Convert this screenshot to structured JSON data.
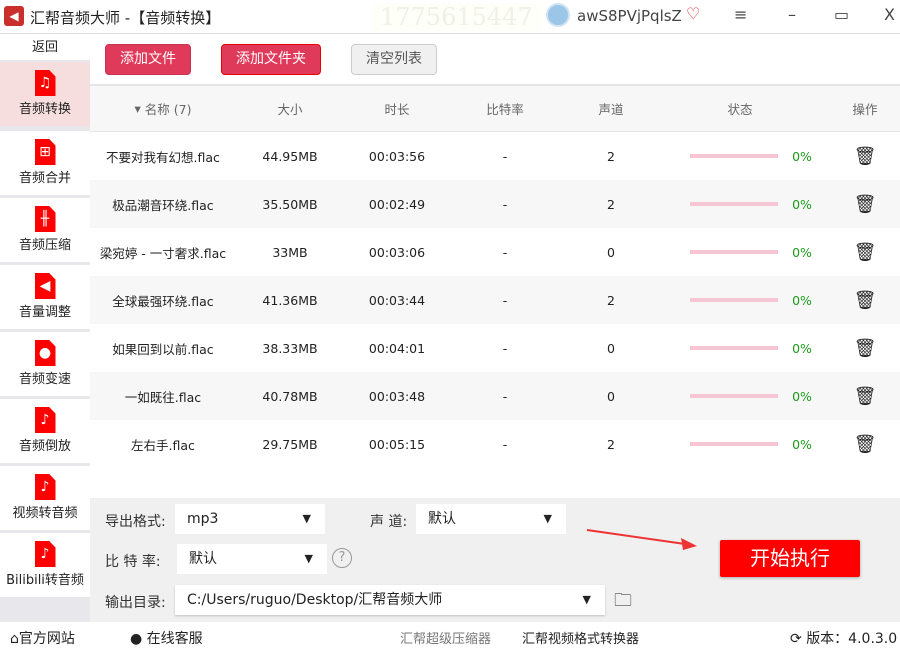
{
  "titlebar": {
    "app_name": "汇帮音频大师",
    "page": "-【音频转换】",
    "watermark": "1775615447",
    "username": "awS8PVjPqlsZ"
  },
  "sidebar": {
    "back": "返回",
    "items": [
      {
        "label": "音频转换",
        "icon": "♫"
      },
      {
        "label": "音频合并",
        "icon": "⊞"
      },
      {
        "label": "音频压缩",
        "icon": "╫"
      },
      {
        "label": "音量调整",
        "icon": "◀"
      },
      {
        "label": "音频变速",
        "icon": "●"
      },
      {
        "label": "音频倒放",
        "icon": "♪"
      },
      {
        "label": "视频转音频",
        "icon": "♪"
      },
      {
        "label": "Bilibili转音频",
        "icon": "♪"
      }
    ]
  },
  "toolbar": {
    "add_file": "添加文件",
    "add_folder": "添加文件夹",
    "clear_list": "清空列表"
  },
  "table": {
    "headers": {
      "name": "名称 (7)",
      "size": "大小",
      "duration": "时长",
      "bitrate": "比特率",
      "channel": "声道",
      "status": "状态",
      "ops": "操作"
    },
    "rows": [
      {
        "name": "不要对我有幻想.flac",
        "size": "44.95MB",
        "duration": "00:03:56",
        "bitrate": "-",
        "channel": "2",
        "progress": "0%"
      },
      {
        "name": "极品潮音环绕.flac",
        "size": "35.50MB",
        "duration": "00:02:49",
        "bitrate": "-",
        "channel": "2",
        "progress": "0%"
      },
      {
        "name": "梁宛婷 - 一寸奢求.flac",
        "size": "33MB",
        "duration": "00:03:06",
        "bitrate": "-",
        "channel": "0",
        "progress": "0%"
      },
      {
        "name": "全球最强环绕.flac",
        "size": "41.36MB",
        "duration": "00:03:44",
        "bitrate": "-",
        "channel": "2",
        "progress": "0%"
      },
      {
        "name": "如果回到以前.flac",
        "size": "38.33MB",
        "duration": "00:04:01",
        "bitrate": "-",
        "channel": "0",
        "progress": "0%"
      },
      {
        "name": "一如既往.flac",
        "size": "40.78MB",
        "duration": "00:03:48",
        "bitrate": "-",
        "channel": "0",
        "progress": "0%"
      },
      {
        "name": "左右手.flac",
        "size": "29.75MB",
        "duration": "00:05:15",
        "bitrate": "-",
        "channel": "2",
        "progress": "0%"
      }
    ]
  },
  "settings": {
    "format_label": "导出格式:",
    "format_value": "mp3",
    "channel_label": "声 道:",
    "channel_value": "默认",
    "bitrate_label": "比 特 率:",
    "bitrate_value": "默认",
    "help": "?",
    "output_label": "输出目录:",
    "output_value": "C:/Users/ruguo/Desktop/汇帮音频大师",
    "start": "开始执行"
  },
  "footer": {
    "website": "官方网站",
    "support": "在线客服",
    "link1": "汇帮超级压缩器",
    "link2": "汇帮视频格式转换器",
    "version": "版本：4.0.3.0"
  },
  "colors": {
    "accent": "#e03a5a",
    "start": "#ff0000",
    "progress": "#f5c6d4"
  }
}
